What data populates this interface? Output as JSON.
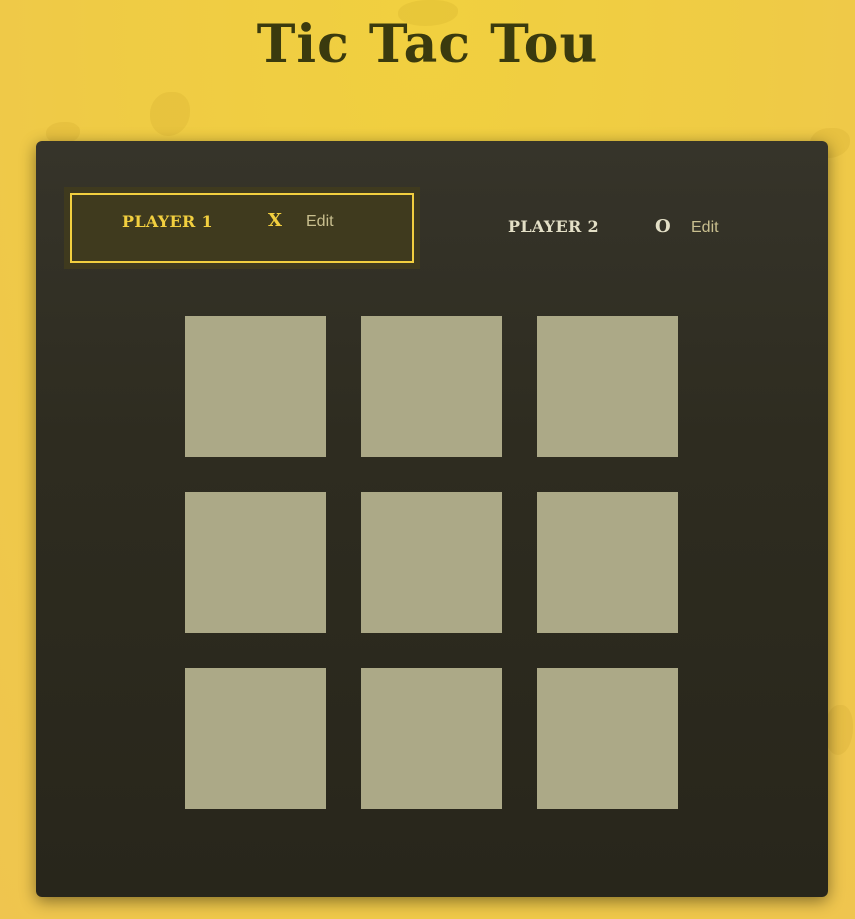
{
  "title": "Tic Tac Tou",
  "colors": {
    "background": "#efcb45",
    "panel": "#2e2c20",
    "accent": "#f2cf3f",
    "cell": "#aca987",
    "title": "#3a3a0e"
  },
  "players": [
    {
      "name": "PLAYER 1",
      "symbol": "X",
      "edit_label": "Edit",
      "active": true
    },
    {
      "name": "PLAYER 2",
      "symbol": "O",
      "edit_label": "Edit",
      "active": false
    }
  ],
  "board": {
    "cells": [
      "",
      "",
      "",
      "",
      "",
      "",
      "",
      "",
      ""
    ]
  }
}
